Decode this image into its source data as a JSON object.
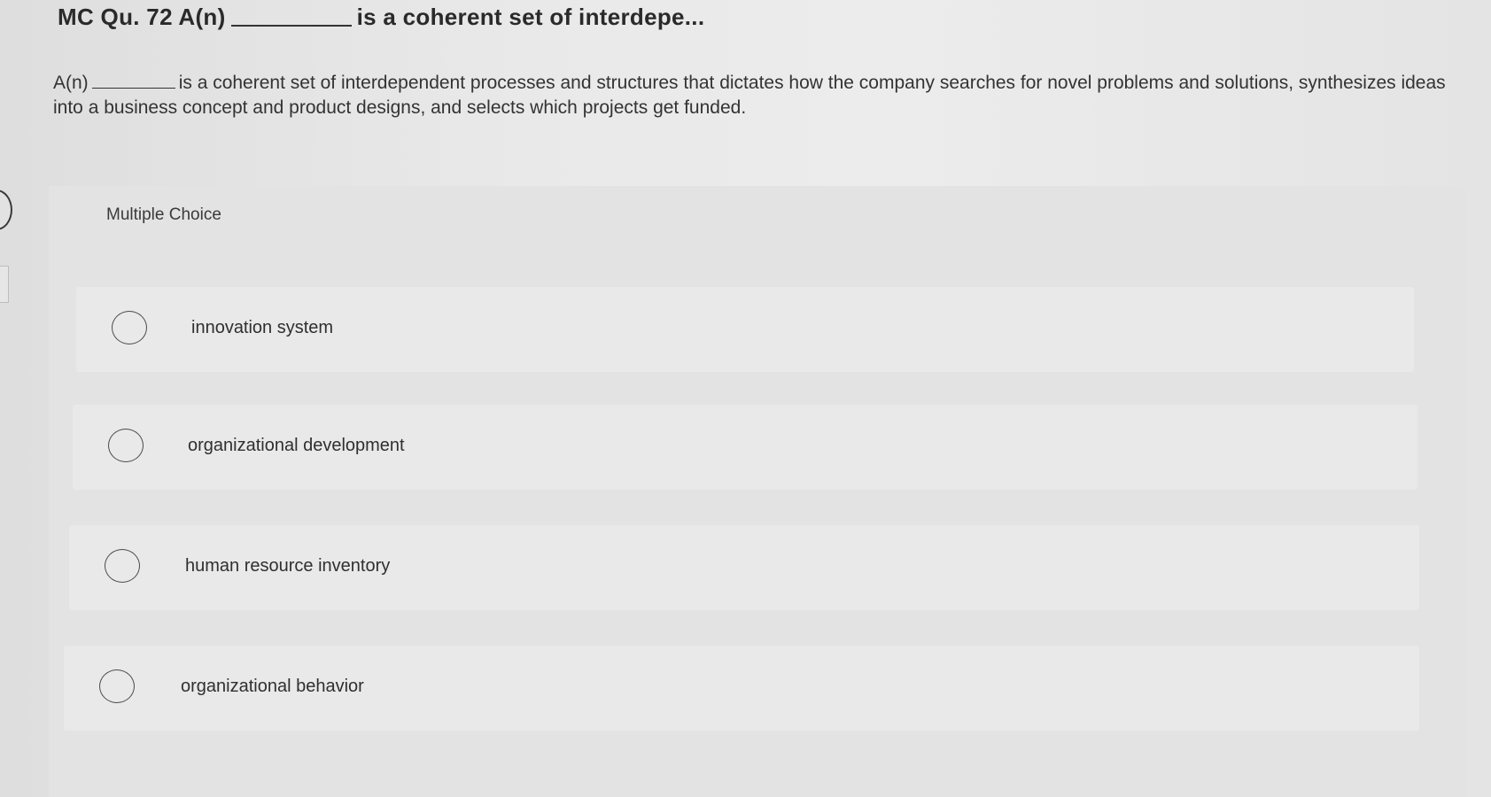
{
  "question": {
    "title_prefix": "MC Qu. 72 A(n)",
    "title_suffix": "is a coherent set of interdepe...",
    "body_prefix": "A(n)",
    "body_text": "is a coherent set of interdependent processes and structures that dictates how the company searches for novel problems and solutions, synthesizes ideas into a business concept and product designs, and selects which projects get funded."
  },
  "choices_section": {
    "label": "Multiple Choice",
    "options": [
      {
        "label": "innovation system",
        "selected": false
      },
      {
        "label": "organizational development",
        "selected": false
      },
      {
        "label": "human resource inventory",
        "selected": false
      },
      {
        "label": "organizational behavior",
        "selected": false
      }
    ]
  }
}
